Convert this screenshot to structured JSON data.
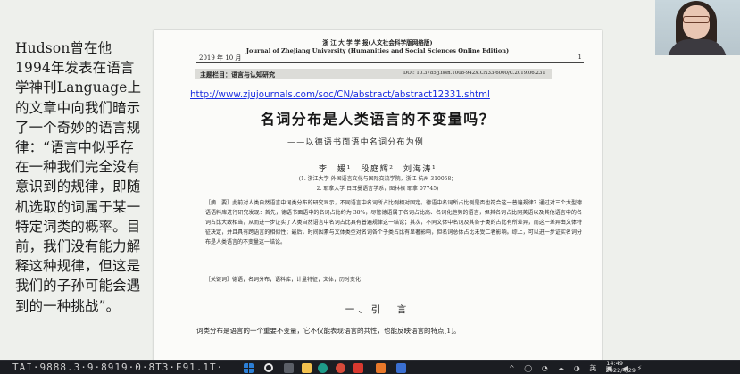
{
  "slide": {
    "left_text": "Hudson曾在他1994年发表在语言学神刊Language上的文章中向我们暗示了一个奇妙的语言规律：“语言中似乎存在一种我们完全没有意识到的规律，即随机选取的词属于某一特定词类的概率。目前，我们没有能力解释这种规律，但这是我们的子孙可能会遇到的一种挑战”。"
  },
  "paper": {
    "date": "2019 年 10 月",
    "journal": "浙 江 大 学 学 报(人文社会科学版网络版)\nJournal of Zhejiang University (Humanities and Social Sciences Online Edition)",
    "page_number": "1",
    "column": "主题栏目：语言与认知研究",
    "doi": "DOI: 10.3785/j.issn.1008-942X.CN33-6000/C.2019.06.231",
    "url": "http://www.zjujournals.com/soc/CN/abstract/abstract12331.shtml",
    "title": "名词分布是人类语言的不变量吗？",
    "subtitle": "——以德语书面语中名词分布为例",
    "authors": "李 媛¹ 段庭辉² 刘海涛¹",
    "affiliation_1": "(1. 浙江大学 外国语言文化与国际交流学院，浙江 杭州 310058；",
    "affiliation_2": "2. 耶拿大学 日耳曼语言学系，图林根 耶拿 07745)",
    "abstract": "［摘　要］此前对人类自然语言中词类分布的研究显示，不同语言中名词所占比例相对固定。德语中名词所占比例是否也符合这一普遍规律？通过对三个大型德语语料库进行研究发现：首先，德语书面语中的名词占比约为 38%，尽管德语属于名词占比高、名词化趋势的语言，但其名词占比同英语以及其他语言中的名词占比大致相当，从而进一步证实了人类自然语言中名词占比具有普遍规律这一结论；其次，不同文体中名词及其各子类的占比有所差异，而这一差异由文体特征决定，并且具有跨语言的相似性；最后，时间因素与文体类型对名词各个子类占比有显著影响，但名词总体占比未受二者影响。综上，可以进一步证实名词分布是人类语言的不变量这一结论。",
    "keywords": "［关键词］德语；名词分布；语料库；计量特征；文体；历时变化",
    "section_title": "一、引　言",
    "intro_line": "词类分布是语言的一个重要不变量，它不仅能表现语言的共性，也能反映语言的特点[1]。"
  },
  "taskbar": {
    "left_overlay": "TAI·9888.3·9·8919·0·8T3·E91.1T·",
    "tray_icons": "^ ◯ ◔ ☁ ◑ 英 ▣ ◀ ⚡",
    "time": "14:49",
    "date": "2022/4/29"
  }
}
